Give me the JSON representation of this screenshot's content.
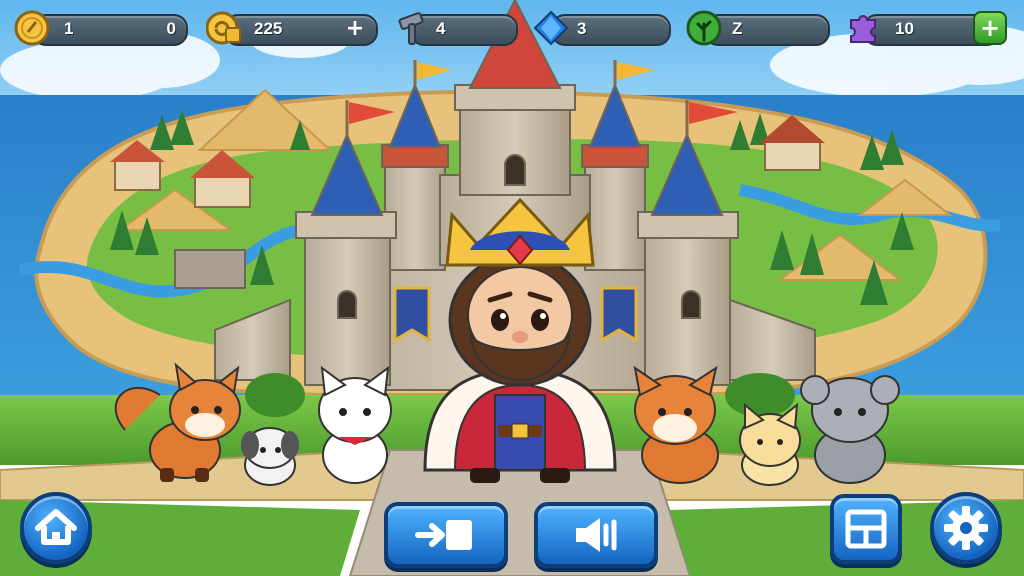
{
  "hud": {
    "coins": {
      "left": "1",
      "right": "0",
      "icon": "gold-coin-icon"
    },
    "gold": {
      "value": "225",
      "plus": "+",
      "icon": "gold-stack-icon"
    },
    "hammer": {
      "value": "4",
      "icon": "hammer-icon"
    },
    "gems": {
      "value": "3",
      "icon": "blue-gem-icon"
    },
    "energy": {
      "value": "Z",
      "icon": "green-leaf-icon"
    },
    "puzzle": {
      "value": "10",
      "plus": "+",
      "icon": "puzzle-piece-icon"
    }
  },
  "buttons": {
    "home": {
      "icon": "home-icon"
    },
    "enter": {
      "icon": "enter-icon"
    },
    "sound": {
      "icon": "speaker-icon"
    },
    "layout": {
      "icon": "layout-icon"
    },
    "settings": {
      "icon": "gear-icon"
    }
  },
  "colors": {
    "sea": "#2f8fd6",
    "land": "#e9c77f",
    "grass": "#5fae3a",
    "button_blue": "#1e88e5",
    "hud_panel": "#4a5d6b",
    "crown_gold": "#f5c542"
  }
}
